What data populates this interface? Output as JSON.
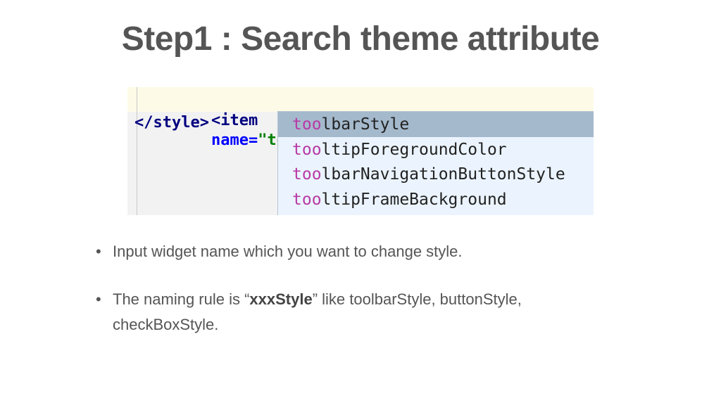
{
  "slide": {
    "title": "Step1 : Search theme attribute"
  },
  "code": {
    "line1_tag": "<item",
    "line1_attr": "name=",
    "line1_value_typed": "\"too",
    "line1_value_close": "\"",
    "line2": "</style>"
  },
  "autocomplete": {
    "typed_prefix": "too",
    "items": [
      {
        "match": "too",
        "rest": "lbarStyle",
        "selected": true
      },
      {
        "match": "too",
        "rest": "ltipForegroundColor",
        "selected": false
      },
      {
        "match": "too",
        "rest": "lbarNavigationButtonStyle",
        "selected": false
      },
      {
        "match": "too",
        "rest": "ltipFrameBackground",
        "selected": false
      }
    ]
  },
  "bullets": {
    "b1": "Input widget name which you want to change style.",
    "b2_pre": "The naming rule is “",
    "b2_bold": "xxxStyle",
    "b2_post": "” like toolbarStyle, buttonStyle, checkBoxStyle."
  }
}
